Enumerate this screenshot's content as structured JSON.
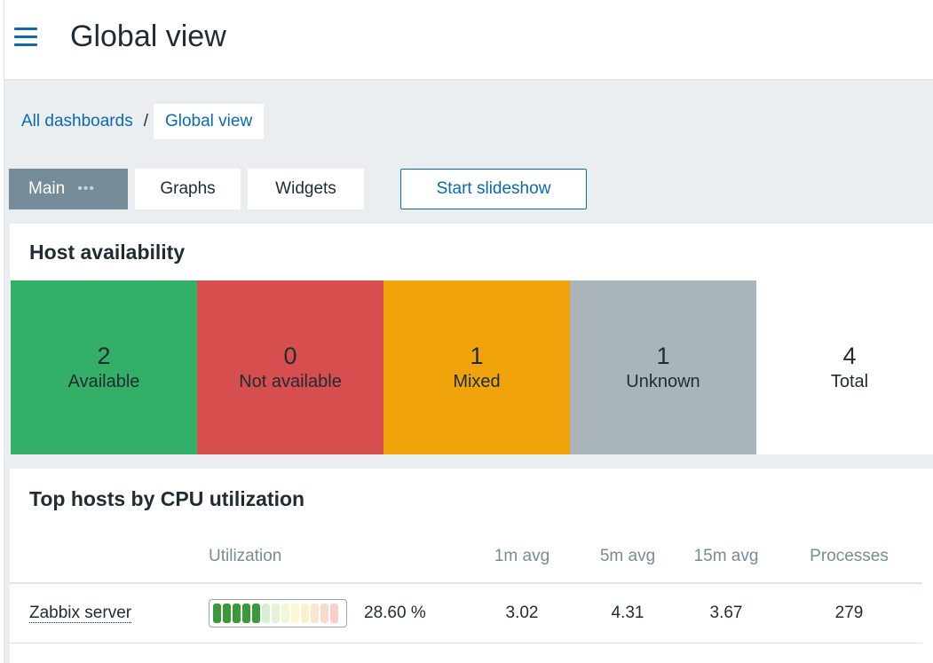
{
  "header": {
    "title": "Global view",
    "menu_icon": "hamburger-menu-icon"
  },
  "breadcrumb": {
    "parent": "All dashboards",
    "separator": "/",
    "current": "Global view"
  },
  "tabs": [
    {
      "label": "Main",
      "active": true,
      "more": "•••"
    },
    {
      "label": "Graphs",
      "active": false
    },
    {
      "label": "Widgets",
      "active": false
    }
  ],
  "slideshow_button": "Start slideshow",
  "host_availability": {
    "title": "Host availability",
    "cells": [
      {
        "count": "2",
        "label": "Available",
        "color": "#34af67"
      },
      {
        "count": "0",
        "label": "Not available",
        "color": "#d64e4e"
      },
      {
        "count": "1",
        "label": "Mixed",
        "color": "#f0a30a"
      },
      {
        "count": "1",
        "label": "Unknown",
        "color": "#aab5bb"
      },
      {
        "count": "4",
        "label": "Total",
        "color": "#ffffff"
      }
    ]
  },
  "top_hosts": {
    "title": "Top hosts by CPU utilization",
    "columns": [
      "Utilization",
      "1m avg",
      "5m avg",
      "15m avg",
      "Processes"
    ],
    "rows": [
      {
        "host": "Zabbix server",
        "utilization": "28.60 %",
        "utilization_fraction": 0.286,
        "avg1": "3.02",
        "avg5": "4.31",
        "avg15": "3.67",
        "processes": "279"
      }
    ]
  }
}
